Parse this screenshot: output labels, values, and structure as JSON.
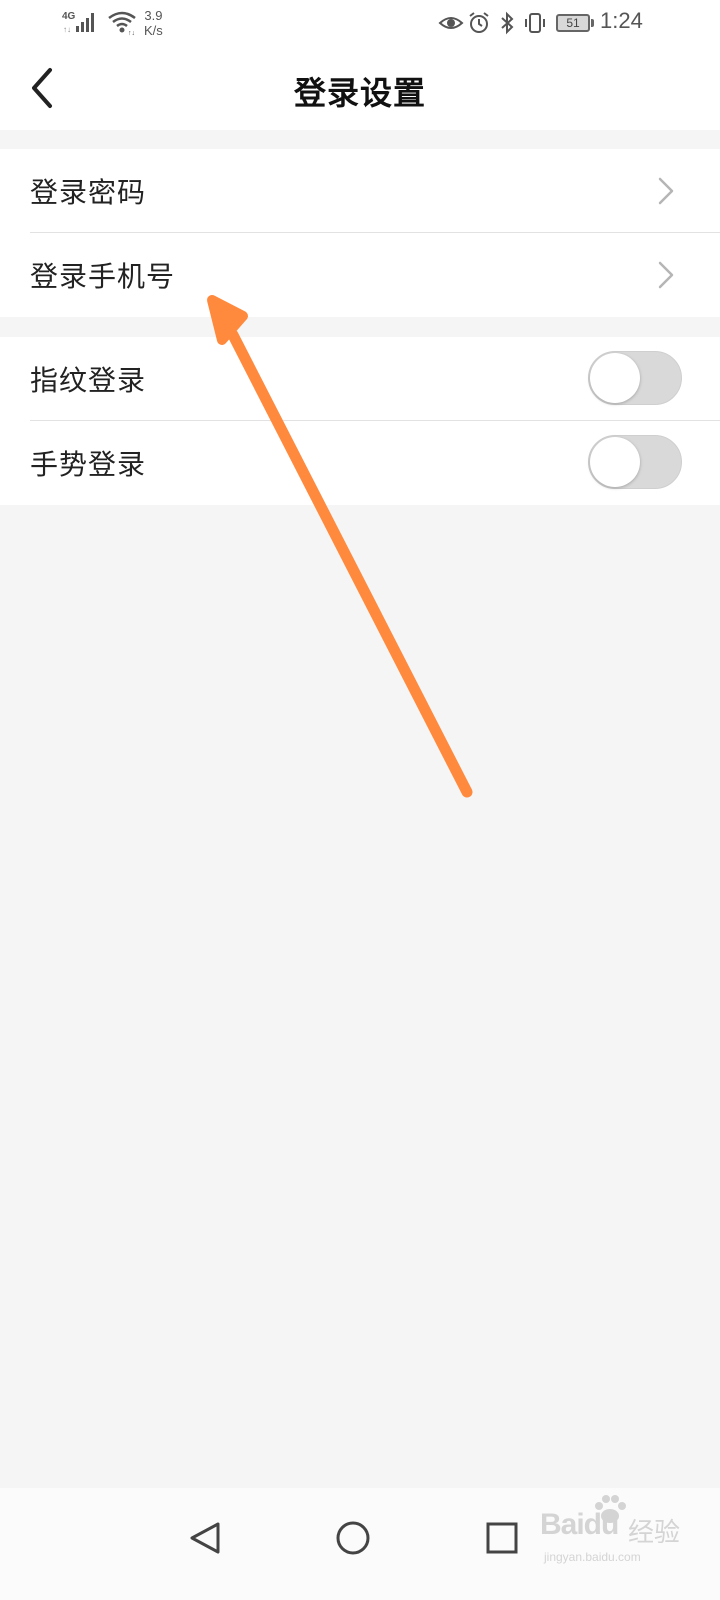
{
  "status_bar": {
    "network_type": "4G",
    "speed_value": "3.9",
    "speed_unit": "K/s",
    "battery_level": "51",
    "time": "1:24",
    "icons": [
      "signal-icon",
      "wifi-icon",
      "eye-icon",
      "alarm-icon",
      "bluetooth-icon",
      "vibrate-icon",
      "battery-icon"
    ]
  },
  "header": {
    "title": "登录设置",
    "back_icon": "chevron-left-icon"
  },
  "settings": {
    "group1": [
      {
        "label": "登录密码",
        "action": "chevron-right-icon"
      },
      {
        "label": "登录手机号",
        "action": "chevron-right-icon"
      }
    ],
    "group2": [
      {
        "label": "指纹登录",
        "enabled": false
      },
      {
        "label": "手势登录",
        "enabled": false
      }
    ]
  },
  "annotation": {
    "type": "arrow",
    "color": "#ff8a3d"
  },
  "navbar": {
    "icons": [
      "nav-back-icon",
      "nav-home-icon",
      "nav-recent-icon"
    ]
  },
  "watermark": {
    "logo": "Baidu",
    "text": "经验",
    "url": "jingyan.baidu.com"
  },
  "colors": {
    "background": "#f5f5f5",
    "surface": "#ffffff",
    "toggle_off": "#d9d9d9",
    "arrow": "#ff8a3d"
  }
}
